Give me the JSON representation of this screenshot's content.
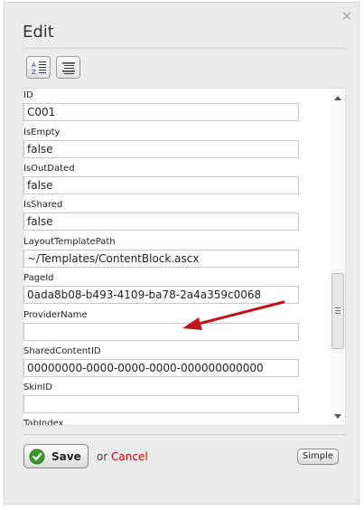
{
  "dialog": {
    "title": "Edit",
    "close_symbol": "×",
    "toolbar": {
      "buttons": [
        {
          "name": "sort-alphabetical-icon",
          "glyph": "A Z"
        },
        {
          "name": "categorized-view-icon"
        }
      ]
    }
  },
  "properties": [
    {
      "label": "ID",
      "value": "C001"
    },
    {
      "label": "IsEmpty",
      "value": "false"
    },
    {
      "label": "IsOutDated",
      "value": "false"
    },
    {
      "label": "IsShared",
      "value": "false"
    },
    {
      "label": "LayoutTemplatePath",
      "value": "~/Templates/ContentBlock.ascx"
    },
    {
      "label": "PageId",
      "value": "0ada8b08-b493-4109-ba78-2a4a359c0068"
    },
    {
      "label": "ProviderName",
      "value": ""
    },
    {
      "label": "SharedContentID",
      "value": "00000000-0000-0000-0000-000000000000"
    },
    {
      "label": "SkinID",
      "value": ""
    },
    {
      "label": "TabIndex",
      "value": ""
    }
  ],
  "footer": {
    "save_label": "Save",
    "or_text": "or",
    "cancel_label": "Cancel",
    "simple_label": "Simple"
  },
  "colors": {
    "annotation_arrow": "#c0141b",
    "cancel_link": "#cc0000",
    "save_check": "#3a9a2a"
  }
}
